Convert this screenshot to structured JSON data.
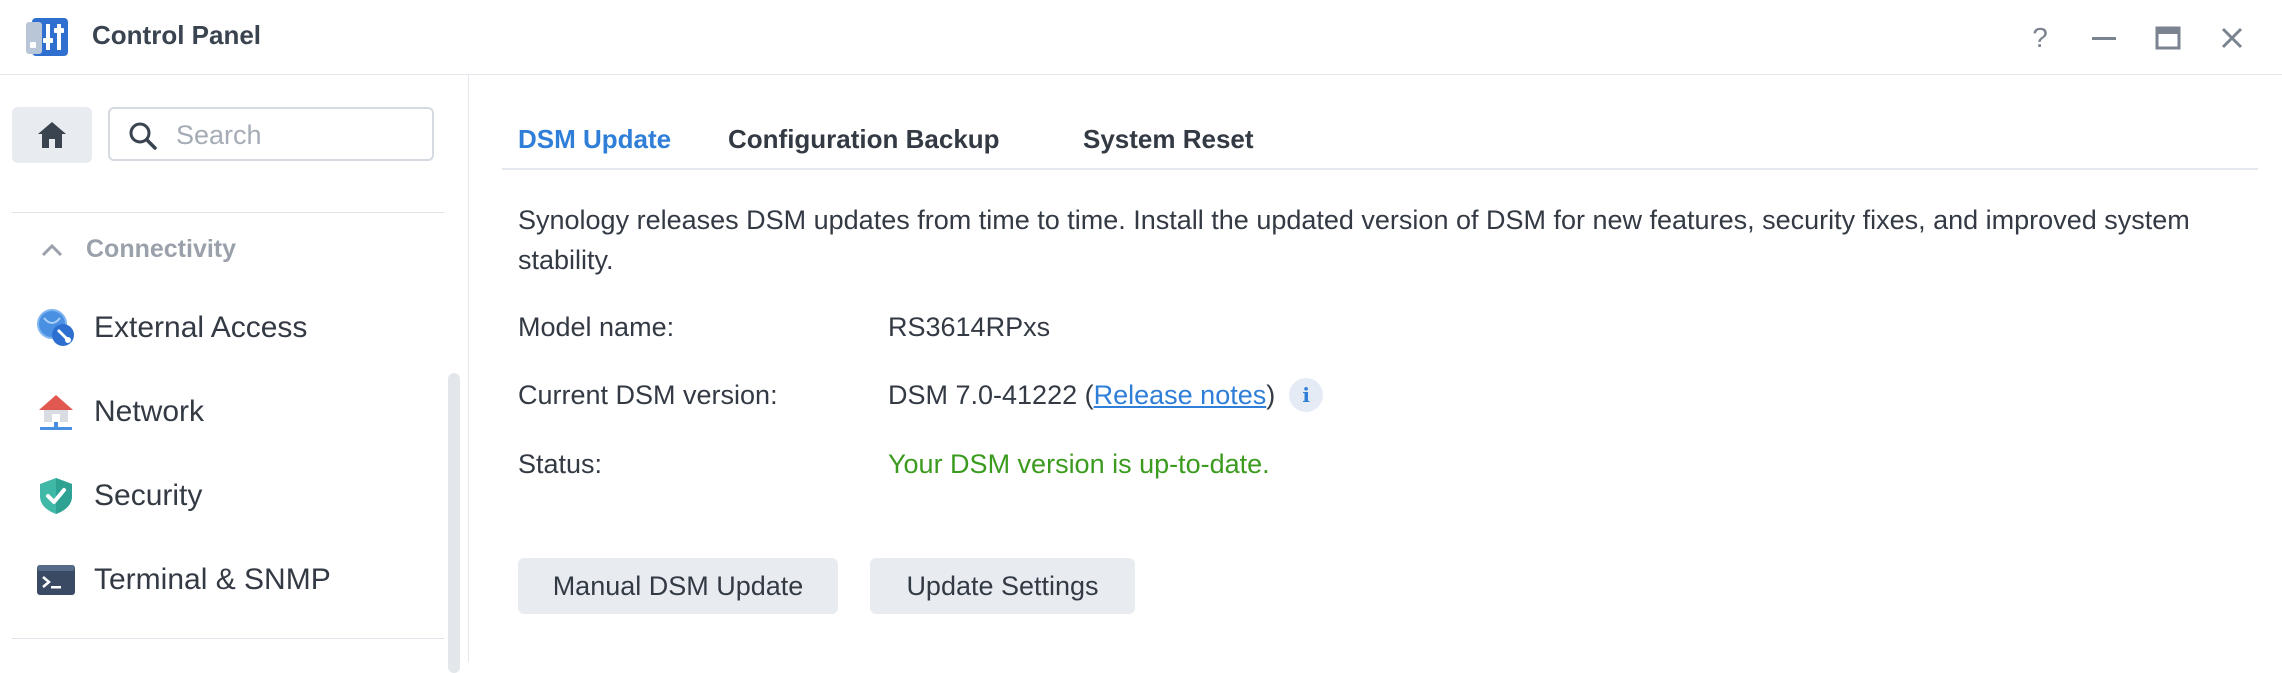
{
  "window": {
    "title": "Control Panel",
    "controls": {
      "help": "?",
      "minimize": "—",
      "close": "✕"
    }
  },
  "sidebar": {
    "search_placeholder": "Search",
    "section": {
      "label": "Connectivity",
      "icon": "chevron-up-icon"
    },
    "items": [
      {
        "label": "External Access",
        "icon": "external-access-icon"
      },
      {
        "label": "Network",
        "icon": "network-house-icon"
      },
      {
        "label": "Security",
        "icon": "shield-check-icon"
      },
      {
        "label": "Terminal & SNMP",
        "icon": "terminal-icon"
      }
    ]
  },
  "tabs": [
    {
      "label": "DSM Update",
      "active": true
    },
    {
      "label": "Configuration Backup",
      "active": false
    },
    {
      "label": "System Reset",
      "active": false
    }
  ],
  "main": {
    "description": "Synology releases DSM updates from time to time. Install the updated version of DSM for new features, security fixes, and improved system stability.",
    "model_label": "Model name:",
    "model_value": "RS3614RPxs",
    "version_label": "Current DSM version:",
    "version_value": "DSM 7.0-41222 (",
    "release_notes_link": "Release notes",
    "version_suffix": ")",
    "info_glyph": "i",
    "status_label": "Status:",
    "status_value": "Your DSM version is up-to-date.",
    "buttons": {
      "manual_update": "Manual DSM Update",
      "update_settings": "Update Settings"
    }
  },
  "colors": {
    "accent": "#2f7fd9",
    "status_ok": "#3b9b1f",
    "button_bg": "#e8ecf1"
  }
}
